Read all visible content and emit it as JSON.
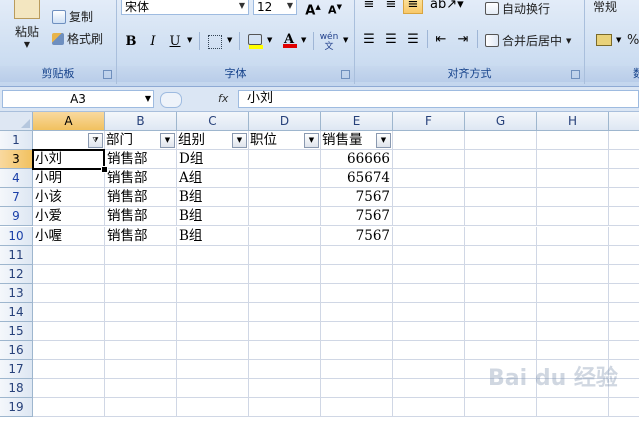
{
  "ribbon": {
    "clipboard": {
      "label": "剪贴板",
      "paste": "粘贴",
      "copy": "复制",
      "format_painter": "格式刷"
    },
    "font": {
      "label": "字体",
      "font_name": "宋体",
      "font_size": "12"
    },
    "alignment": {
      "label": "对齐方式",
      "wrap_text": "自动换行",
      "merge_center": "合并后居中"
    },
    "number": {
      "label": "数",
      "format": "常规",
      "percent": "%"
    }
  },
  "formula_bar": {
    "name_box": "A3",
    "fx": "fx",
    "content": "小刘"
  },
  "columns": [
    "A",
    "B",
    "C",
    "D",
    "E",
    "F",
    "G",
    "H"
  ],
  "rows": [
    "1",
    "3",
    "4",
    "7",
    "9",
    "10",
    "11",
    "12",
    "13",
    "14",
    "15",
    "16",
    "17",
    "18",
    "19"
  ],
  "header_row": [
    "",
    "部门",
    "组别",
    "职位",
    "销售量"
  ],
  "data_rows": [
    [
      "小刘",
      "销售部",
      "D组",
      "",
      "66666"
    ],
    [
      "小明",
      "销售部",
      "A组",
      "",
      "65674"
    ],
    [
      "小该",
      "销售部",
      "B组",
      "",
      "7567"
    ],
    [
      "小爱",
      "销售部",
      "B组",
      "",
      "7567"
    ],
    [
      "小喔",
      "销售部",
      "B组",
      "",
      "7567"
    ]
  ],
  "watermark": "Bai du 经验"
}
